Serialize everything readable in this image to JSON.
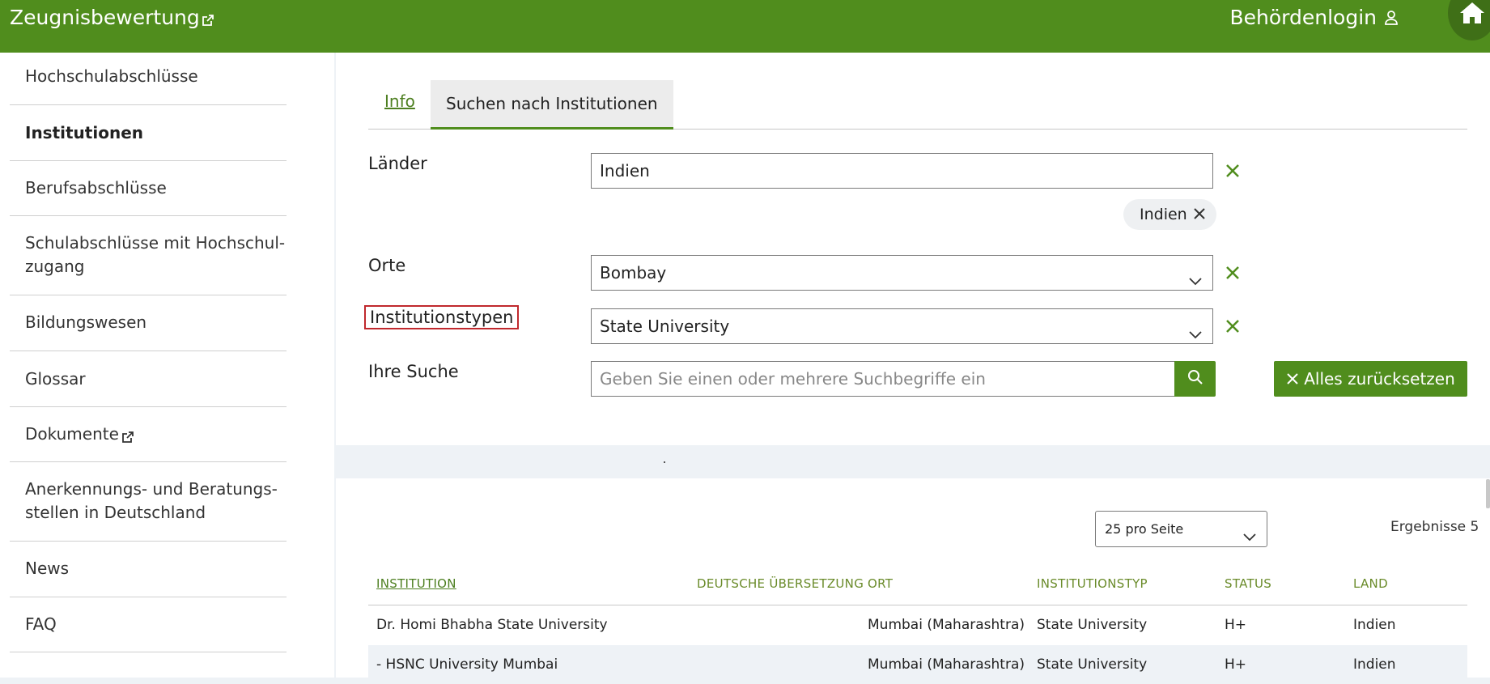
{
  "header": {
    "brand": "Zeugnisbewertung",
    "login": "Behördenlogin",
    "colors": {
      "primary": "#508d1d",
      "home_circle": "#3f6f17"
    }
  },
  "icons": {
    "brand_external": "external-link-icon",
    "user": "user-icon",
    "home": "home-icon"
  },
  "sidebar": {
    "items": [
      {
        "label": "Hochschulabschlüsse"
      },
      {
        "label": "Institutionen"
      },
      {
        "label": "Berufsabschlüsse"
      },
      {
        "label": "Schulabschlüsse mit Hochschul-",
        "label2": "zugang"
      },
      {
        "label": "Bildungswesen"
      },
      {
        "label": "Glossar"
      },
      {
        "label": "Dokumente"
      },
      {
        "label": "Anerkennungs- und Beratungs-",
        "label2": "stellen in Deutschland"
      },
      {
        "label": "News"
      },
      {
        "label": "FAQ"
      }
    ]
  },
  "tabs": [
    {
      "label": "Info"
    },
    {
      "label": "Suchen nach Institutionen"
    }
  ],
  "form": {
    "countries": {
      "label": "Länder",
      "value": "Indien",
      "chip": "Indien"
    },
    "cities": {
      "label": "Orte",
      "value": "Bombay"
    },
    "types": {
      "label": "Institutionstypen",
      "value": "State University"
    },
    "search": {
      "label": "Ihre Suche",
      "placeholder": "Geben Sie einen oder mehrere Suchbegriffe ein"
    },
    "reset_label": "Alles zurücksetzen"
  },
  "results": {
    "per_page": "25 pro Seite",
    "count": "Ergebnisse 5",
    "columns": [
      "INSTITUTION",
      "DEUTSCHE ÜBERSETZUNG",
      "ORT",
      "INSTITUTIONSTYP",
      "STATUS",
      "LAND"
    ],
    "rows": [
      {
        "institution": "Dr. Homi Bhabha State University",
        "translation": "",
        "city": "Mumbai (Maharashtra)",
        "type": "State University",
        "status": "H+",
        "country": "Indien"
      },
      {
        "institution": "- HSNC University Mumbai",
        "translation": "",
        "city": "Mumbai (Maharashtra)",
        "type": "State University",
        "status": "H+",
        "country": "Indien"
      }
    ]
  }
}
